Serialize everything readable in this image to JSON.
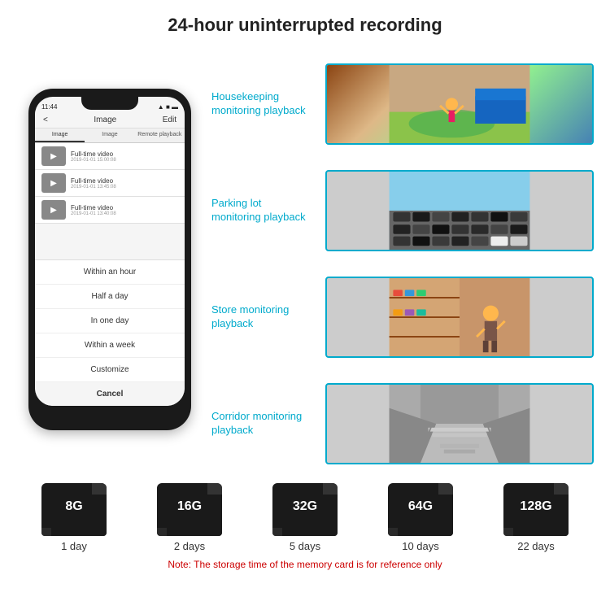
{
  "header": {
    "title": "24-hour uninterrupted recording"
  },
  "phone": {
    "time": "11:44",
    "screen_title": "Image",
    "edit_button": "Edit",
    "back_arrow": "<",
    "tabs": [
      "Image",
      "Image",
      "Remote playback"
    ],
    "videos": [
      {
        "title": "Full-time video",
        "date": "2019-01-01 15:00:08"
      },
      {
        "title": "Full-time video",
        "date": "2019-01-01 13:45:08"
      },
      {
        "title": "Full-time video",
        "date": "2019-01-01 13:40:08"
      }
    ],
    "dropdown_items": [
      "Within an hour",
      "Half a day",
      "In one day",
      "Within a week",
      "Customize"
    ],
    "cancel_label": "Cancel"
  },
  "monitoring": [
    {
      "label": "Housekeeping\nmonitoring playback",
      "photo_type": "housekeeping"
    },
    {
      "label": "Parking lot\nmonitoring playback",
      "photo_type": "parking"
    },
    {
      "label": "Store monitoring\nplayback",
      "photo_type": "store"
    },
    {
      "label": "Corridor monitoring\nplayback",
      "photo_type": "corridor"
    }
  ],
  "storage": {
    "cards": [
      {
        "size": "8G",
        "days": "1 day"
      },
      {
        "size": "16G",
        "days": "2 days"
      },
      {
        "size": "32G",
        "days": "5 days"
      },
      {
        "size": "64G",
        "days": "10 days"
      },
      {
        "size": "128G",
        "days": "22 days"
      }
    ],
    "note": "Note: The storage time of the memory card is for reference only"
  }
}
